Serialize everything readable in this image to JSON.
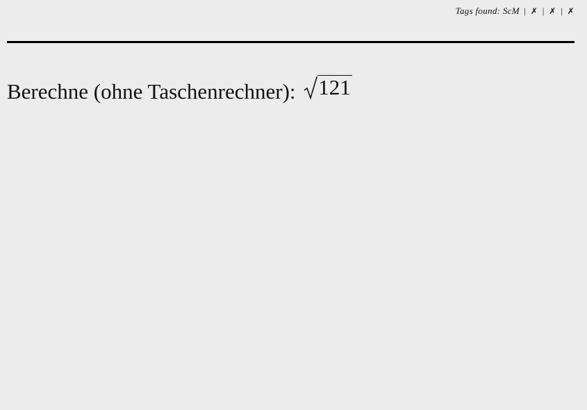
{
  "tags": {
    "label": "Tags found:",
    "items": [
      "ScM",
      "✗",
      "✗",
      "✗"
    ],
    "separator": "|"
  },
  "question": {
    "prefix": "Berechne (ohne Taschenrechner):",
    "radicand": "121",
    "math_icon": "square-root-icon"
  }
}
